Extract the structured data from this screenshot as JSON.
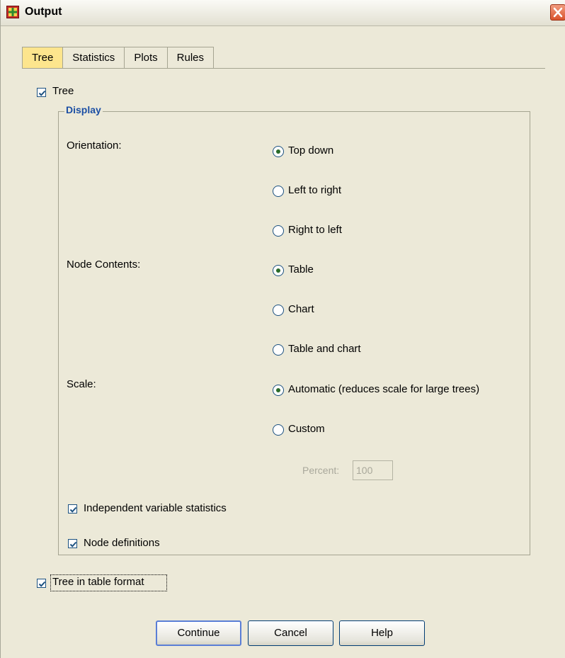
{
  "window": {
    "title": "Output"
  },
  "tabs": [
    {
      "label": "Tree",
      "active": true
    },
    {
      "label": "Statistics",
      "active": false
    },
    {
      "label": "Plots",
      "active": false
    },
    {
      "label": "Rules",
      "active": false
    }
  ],
  "tree_checkbox": {
    "label": "Tree",
    "checked": true
  },
  "display_group": {
    "title": "Display",
    "orientation": {
      "label": "Orientation:",
      "options": [
        {
          "label": "Top down",
          "selected": true
        },
        {
          "label": "Left to right",
          "selected": false
        },
        {
          "label": "Right to left",
          "selected": false
        }
      ]
    },
    "node_contents": {
      "label": "Node Contents:",
      "options": [
        {
          "label": "Table",
          "selected": true
        },
        {
          "label": "Chart",
          "selected": false
        },
        {
          "label": "Table and chart",
          "selected": false
        }
      ]
    },
    "scale": {
      "label": "Scale:",
      "options": [
        {
          "label": "Automatic (reduces scale for large trees)",
          "selected": true
        },
        {
          "label": "Custom",
          "selected": false
        }
      ],
      "percent_label": "Percent:",
      "percent_value": "100"
    },
    "independent_variable_statistics": {
      "label": "Independent variable statistics",
      "checked": true
    },
    "node_definitions": {
      "label": "Node definitions",
      "checked": true
    }
  },
  "tree_in_table_format": {
    "label": "Tree in table format",
    "checked": true
  },
  "buttons": {
    "continue": "Continue",
    "cancel": "Cancel",
    "help": "Help"
  },
  "colors": {
    "active_tab": "#fde58d",
    "group_title": "#1c4fa4",
    "default_button_border": "#5a7ed6"
  },
  "icons": [
    "app-icon",
    "close-icon",
    "check-icon",
    "radio-dot-icon"
  ]
}
